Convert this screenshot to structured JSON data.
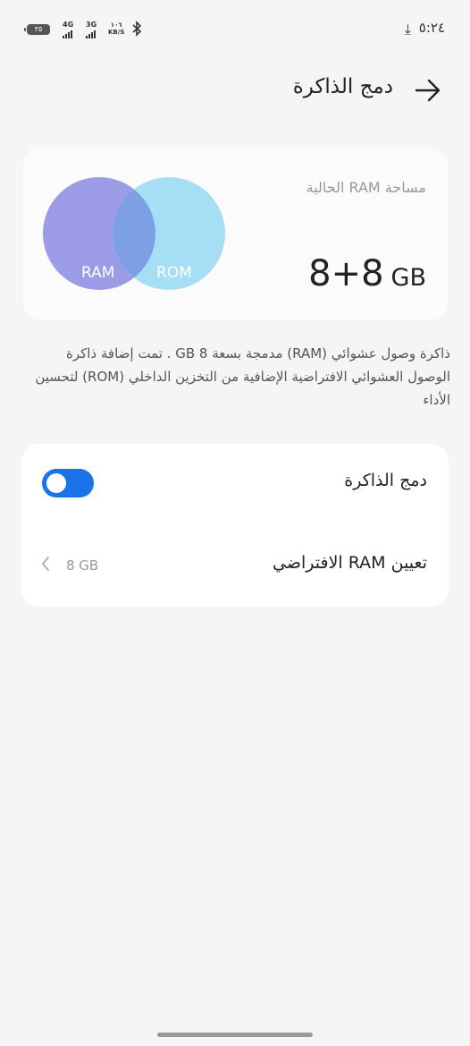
{
  "status_bar": {
    "time": "٥:٢٤",
    "battery": "٣٥",
    "signal1_label": "4G",
    "signal2_label": "3G",
    "net_speed_value": "١٠٦",
    "net_speed_unit": "KB/S"
  },
  "header": {
    "title": "دمج الذاكرة"
  },
  "summary_card": {
    "label": "مساحة RAM الحالية",
    "value": "8+8",
    "unit": "GB",
    "venn_left_label": "RAM",
    "venn_right_label": "ROM",
    "colors": {
      "ram": "#9b9be6",
      "rom": "#a6def5",
      "overlap": "#7d9fe4"
    }
  },
  "description": "ذاكرة وصول عشوائي (RAM) مدمجة بسعة 8 GB . تمت إضافة ذاكرة الوصول العشوائي الافتراضية الإضافية من التخزين الداخلي (ROM) لتحسين الأداء",
  "settings": {
    "toggle_label": "دمج الذاكرة",
    "toggle_on": true,
    "ram_row_label": "تعيين RAM الافتراضي",
    "ram_row_value": "8 GB"
  },
  "accent_color": "#1a73e8"
}
